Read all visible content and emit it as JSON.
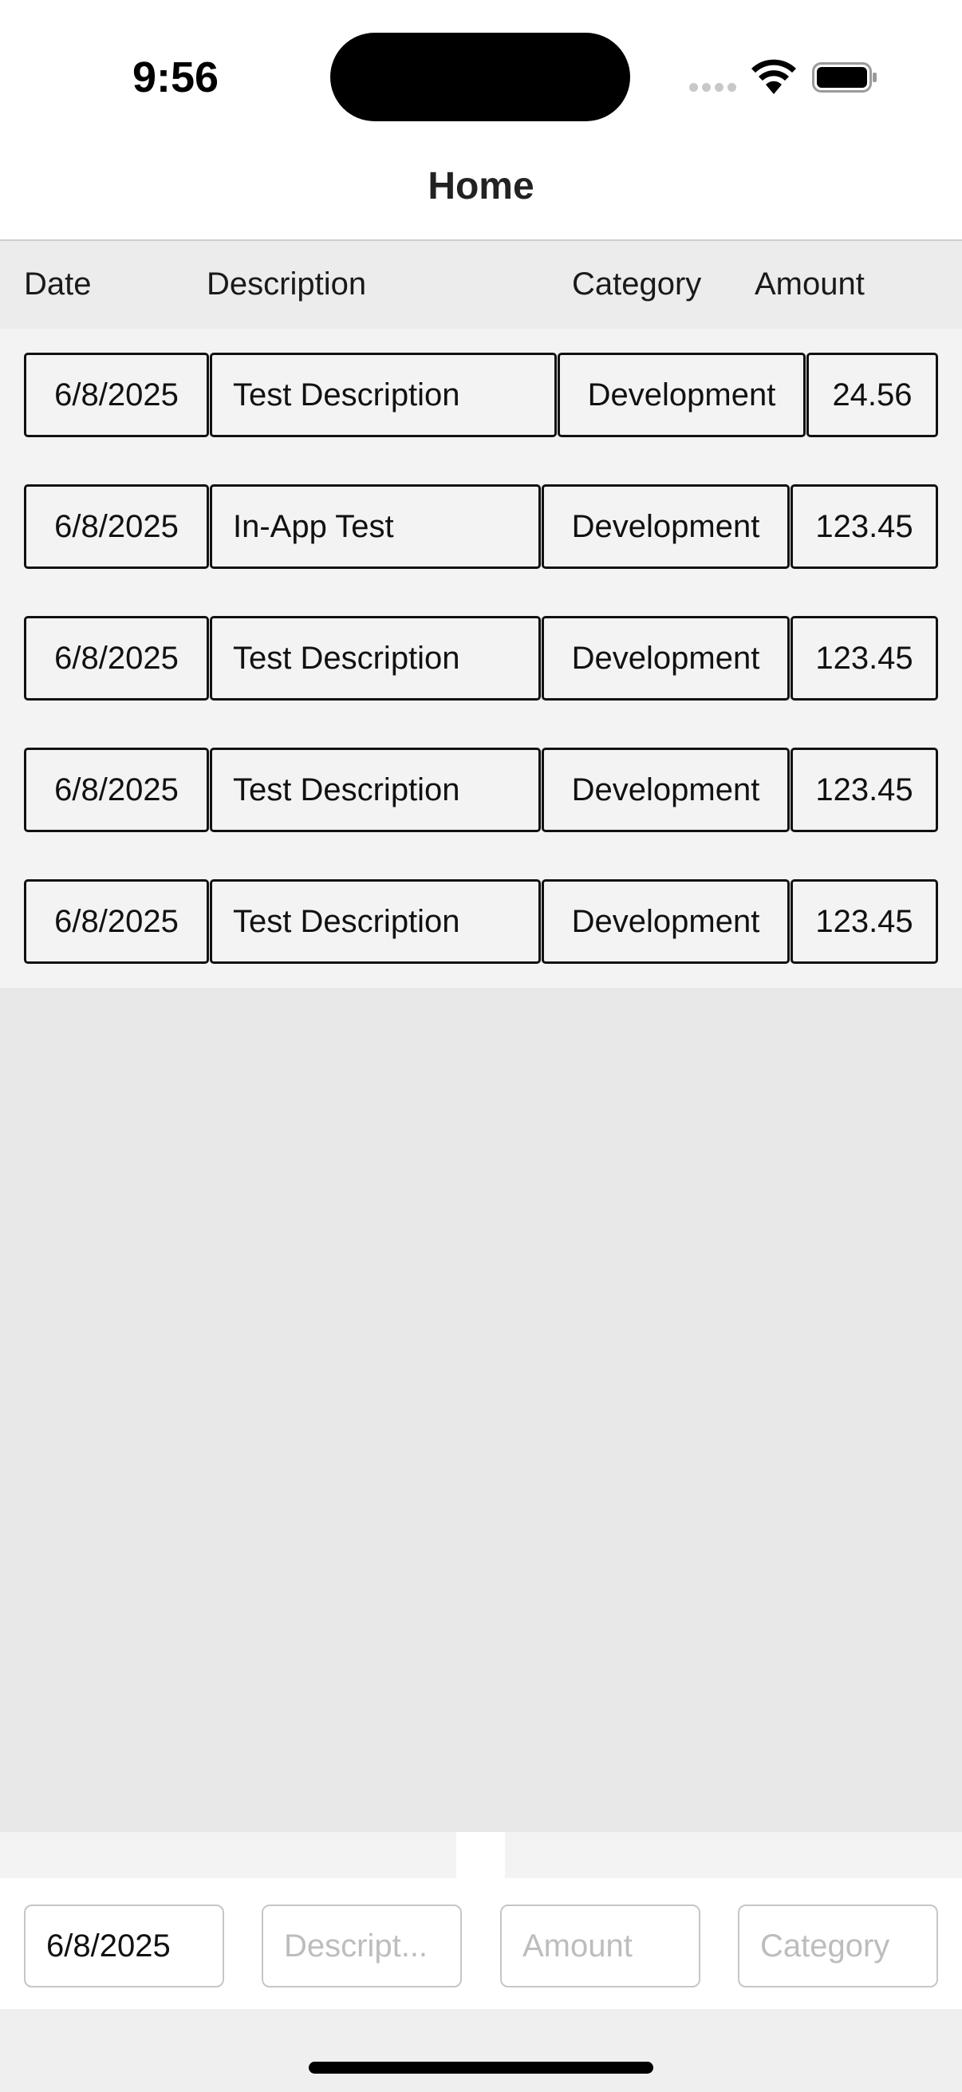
{
  "status_bar": {
    "time": "9:56"
  },
  "nav": {
    "title": "Home"
  },
  "table": {
    "headers": {
      "date": "Date",
      "description": "Description",
      "category": "Category",
      "amount": "Amount"
    },
    "rows": [
      {
        "date": "6/8/2025",
        "description": "Test Description",
        "category": "Development",
        "amount": "24.56"
      },
      {
        "date": "6/8/2025",
        "description": "In-App Test",
        "category": "Development",
        "amount": "123.45"
      },
      {
        "date": "6/8/2025",
        "description": "Test Description",
        "category": "Development",
        "amount": "123.45"
      },
      {
        "date": "6/8/2025",
        "description": "Test Description",
        "category": "Development",
        "amount": "123.45"
      },
      {
        "date": "6/8/2025",
        "description": "Test Description",
        "category": "Development",
        "amount": "123.45"
      }
    ]
  },
  "input_bar": {
    "date_value": "6/8/2025",
    "description_placeholder": "Descript...",
    "amount_placeholder": "Amount",
    "category_placeholder": "Category"
  },
  "colors": {
    "table_background": "#f3f3f3",
    "header_background": "#ececec",
    "empty_background": "#e8e8e8",
    "cell_border": "#111111",
    "placeholder": "#bdbdbd"
  },
  "icons": [
    "cellular-signal-icon",
    "wifi-icon",
    "battery-icon"
  ]
}
